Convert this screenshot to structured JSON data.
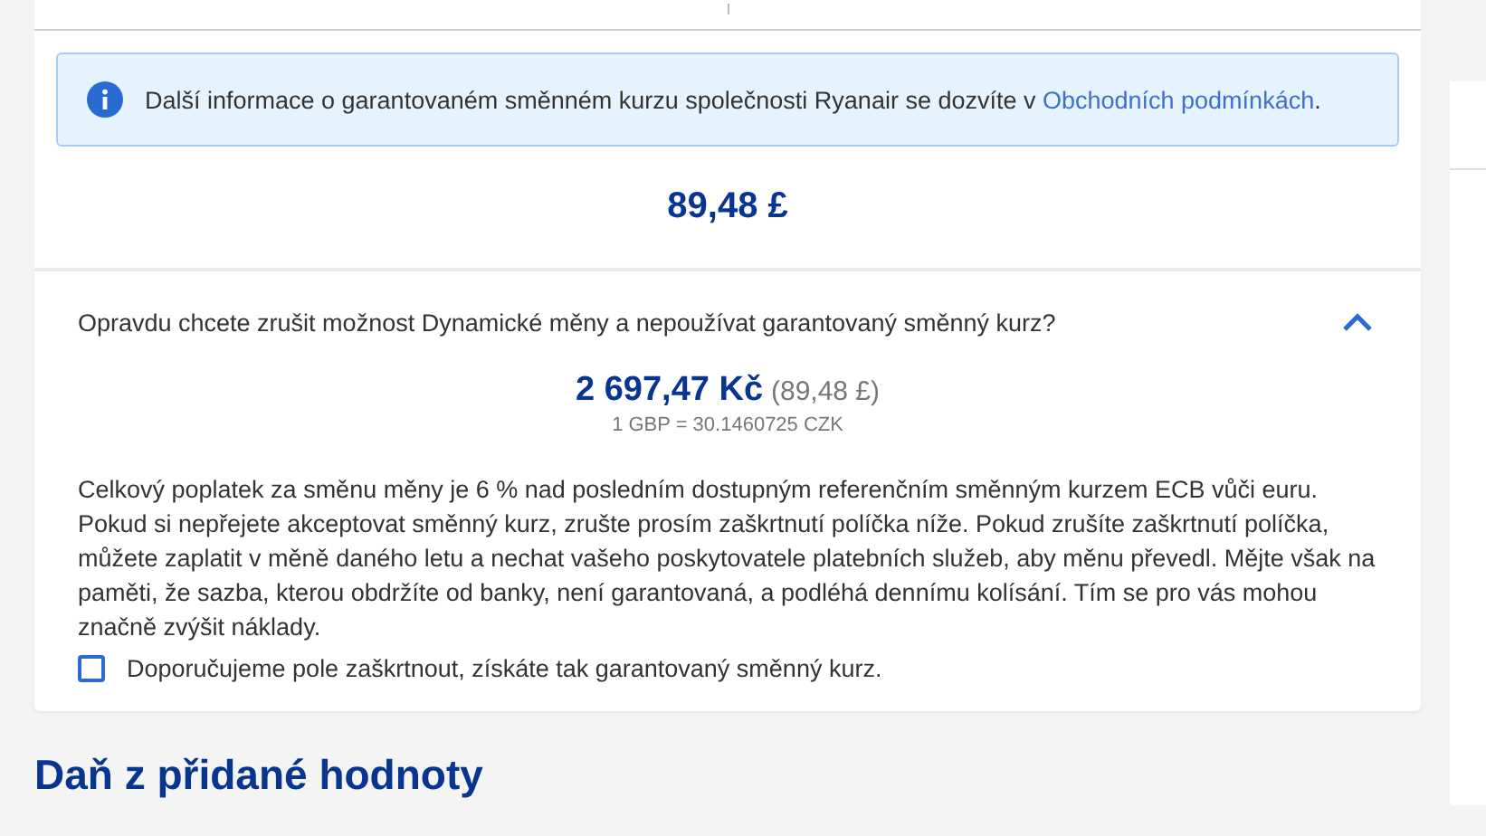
{
  "notice": {
    "text": "Další informace o garantovaném směnném kurzu společnosti Ryanair se dozvíte v ",
    "link": "Obchodních podmínkách",
    "after": "."
  },
  "price": "89,48 £",
  "dcc": {
    "question": "Opravdu chcete zrušit možnost Dynamické měny a nepoužívat garantovaný směnný kurz?",
    "expanded": true,
    "amount": "2 697,47 Kč",
    "original": "(89,48 £)",
    "rate": "1 GBP = 30.1460725 CZK",
    "description": "Celkový poplatek za směnu měny je 6 % nad posledním dostupným referenčním směnným kurzem ECB vůči euru. Pokud si nepřejete akceptovat směnný kurz, zrušte prosím zaškrtnutí políčka níže. Pokud zrušíte zaškrtnutí políčka, můžete zaplatit v měně daného letu a nechat vašeho poskytovatele platebních služeb, aby měnu převedl. Mějte však na paměti, že sazba, kterou obdržíte od banky, není garantovaná, a podléhá dennímu kolísání. Tím se pro vás mohou značně zvýšit náklady.",
    "checkbox": {
      "label": "Doporučujeme pole zaškrtnout, získáte tak garantovaný směnný kurz.",
      "checked": false
    }
  },
  "heading": "Daň z přidané hodnoty"
}
